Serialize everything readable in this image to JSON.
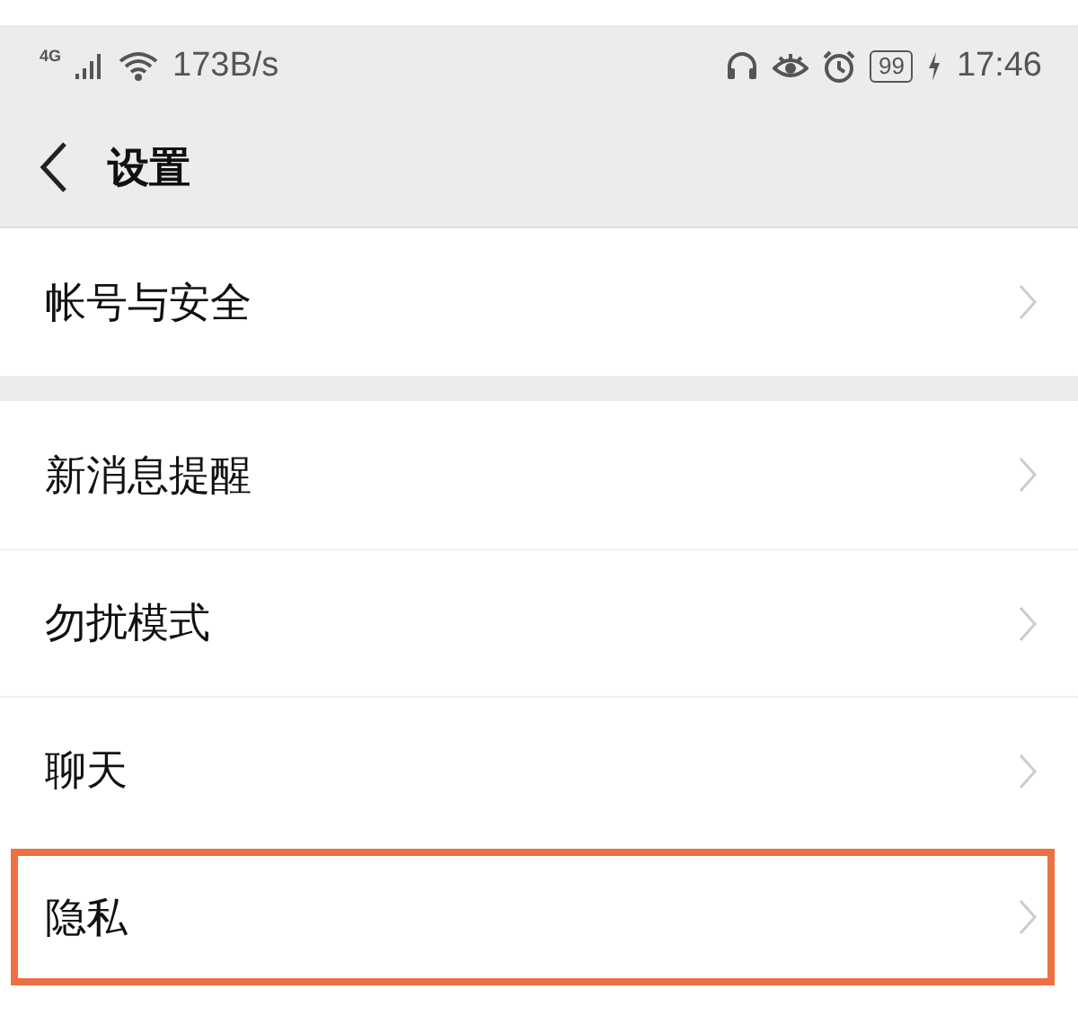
{
  "status_bar": {
    "network": "4G",
    "speed": "173B/s",
    "battery": "99",
    "time": "17:46"
  },
  "nav": {
    "title": "设置"
  },
  "groups": [
    {
      "items": [
        {
          "label": "帐号与安全",
          "highlighted": false
        }
      ]
    },
    {
      "items": [
        {
          "label": "新消息提醒",
          "highlighted": false
        },
        {
          "label": "勿扰模式",
          "highlighted": false
        },
        {
          "label": "聊天",
          "highlighted": false
        },
        {
          "label": "隐私",
          "highlighted": true
        }
      ]
    }
  ]
}
